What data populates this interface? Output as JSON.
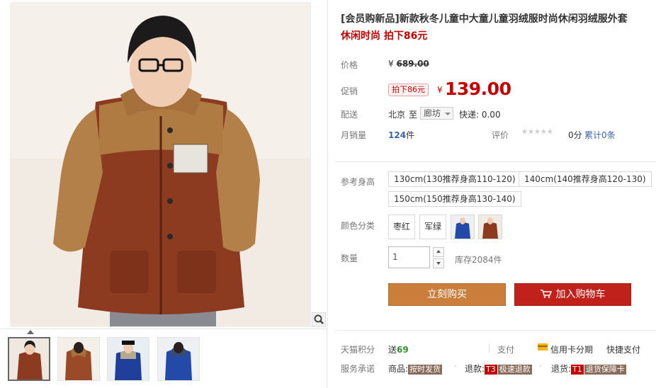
{
  "product": {
    "title": "[会员购新品]新款秋冬儿童中大童儿童羽绒服时尚休闲羽绒服外套",
    "subtitle": "休闲时尚 拍下86元"
  },
  "price": {
    "label": "价格",
    "currency": "¥",
    "original": "689.00"
  },
  "promo": {
    "label": "促销",
    "badge": "拍下86元",
    "currency": "¥",
    "price": "139.00"
  },
  "shipping": {
    "label": "配送",
    "from": "北京",
    "to_word": "至",
    "destination": "廊坊",
    "fee": "快递: 0.00"
  },
  "sales": {
    "label": "月销量",
    "count": "124",
    "unit": "件",
    "rating_label": "评价",
    "stars": "★★★★★",
    "score": "0分",
    "reviews": "累计0条"
  },
  "size": {
    "label": "参考身高",
    "options": [
      "130cm(130推荐身高110-120)",
      "140cm(140推荐身高120-130)",
      "150cm(150推荐身高130-140)"
    ]
  },
  "color": {
    "label": "颜色分类",
    "options": [
      "枣红",
      "军绿"
    ]
  },
  "quantity": {
    "label": "数量",
    "value": "1",
    "stock": "库存2084件"
  },
  "actions": {
    "buy": "立刻购买",
    "cart": "加入购物车"
  },
  "footer": {
    "points_label": "天猫积分",
    "points_prefix": "送",
    "points_value": "69",
    "pay_label": "支付",
    "credit": "信用卡分期",
    "quick_pay": "快捷支付",
    "promise_label": "服务承诺",
    "goods_label": "商品:",
    "goods_tag": "按时发货",
    "refund_label": "退款:",
    "refund_code": "T3",
    "refund_tag": "极速退款",
    "return_label": "退货:",
    "return_code": "T1",
    "return_tag": "退货保障卡"
  },
  "colors": {
    "accent_red": "#c40000",
    "buy_orange": "#c97e3c",
    "cart_red": "#c0211a",
    "link_blue": "#3c66a8"
  }
}
